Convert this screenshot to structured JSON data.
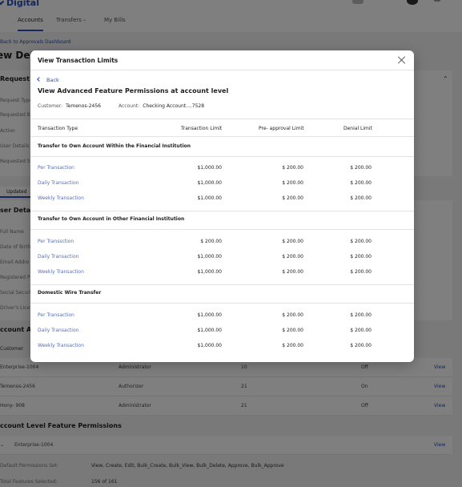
{
  "background": {
    "brand": "Digital",
    "nav": [
      "Accounts",
      "Transfers",
      "My Bills"
    ],
    "breadcrumb": "Back to Approvals Dashboard",
    "page_title": "ew Deta",
    "request_details_title": "Request De",
    "request_fields": [
      "Request Type",
      "Requested B",
      "Action",
      "User Details",
      "Requested S"
    ],
    "tab_updated": "Updated",
    "user_details_title": "ser Details",
    "user_fields": [
      "Full Name",
      "Date of Birth",
      "Email Addre",
      "Registered P",
      "Social Securi",
      "Driver's Lice"
    ],
    "account_access_title": "ccount Acc",
    "customer_header": "Customer",
    "rows": [
      {
        "name": "Enterprise-1004",
        "role": "Administrator",
        "count": "10",
        "status": "Off",
        "action": "View"
      },
      {
        "name": "Temenos-2456",
        "role": "Authorizer",
        "count": "21",
        "status": "On",
        "action": "View"
      },
      {
        "name": "Hony- 908",
        "role": "Administrator",
        "count": "21",
        "status": "Off",
        "action": "View"
      }
    ],
    "feature_perm_title": "ccount Level Feature Permissions",
    "feature_row": {
      "name": "Enterprise-1004",
      "action": "View"
    },
    "default_permissions_label": "Default Permissions Set:",
    "default_permissions_value": "View, Create, Edit, Bulk_Create, Bulk_View, Bulk_Delete, Approve, Bulk_Approve",
    "total_features_label": "Total Features Selected:",
    "total_features_value": "156 of 161"
  },
  "modal": {
    "title": "View Transaction Limits",
    "back_label": "Back",
    "subtitle": "View Advanced Feature Permissions at account level",
    "customer_label": "Customer:",
    "customer_value": "Temenos-2456",
    "account_label": "Account:",
    "account_value": "Checking Account....7528",
    "columns": [
      "Transaction Type",
      "Transaction Limit",
      "Pre- approval Limit",
      "Denial Limit"
    ],
    "groups": [
      {
        "title": "Transfer to Own Account Within the Financial Institution",
        "rows": [
          {
            "type": "Per Transaction",
            "limit": "$1,000.00",
            "pre": "$ 200.00",
            "denial": "$ 200.00"
          },
          {
            "type": "Daily Transaction",
            "limit": "$1,000.00",
            "pre": "$ 200.00",
            "denial": "$ 200.00"
          },
          {
            "type": "Weekly Transaction",
            "limit": "$1,000.00",
            "pre": "$ 200.00",
            "denial": "$ 200.00"
          }
        ]
      },
      {
        "title": "Transfer to Own Account in Other Financial Institution",
        "rows": [
          {
            "type": "Per Transsction",
            "limit": "$ 200.00",
            "pre": "$ 200.00",
            "denial": "$ 200.00"
          },
          {
            "type": "Daily Transaction",
            "limit": "$1,000.00",
            "pre": "$ 200.00",
            "denial": "$ 200.00"
          },
          {
            "type": "Weekly Transaction",
            "limit": "$1,000.00",
            "pre": "$ 200.00",
            "denial": "$ 200.00"
          }
        ]
      },
      {
        "title": "Domestic Wire Transfer",
        "rows": [
          {
            "type": "Per Transaction",
            "limit": "$1,000.00",
            "pre": "$ 200.00",
            "denial": "$ 200.00"
          },
          {
            "type": "Daily Transaction",
            "limit": "$1,000.00",
            "pre": "$ 200.00",
            "denial": "$ 200.00"
          },
          {
            "type": "Weekly Transaction",
            "limit": "$1,000.00",
            "pre": "$ 200.00",
            "denial": "$ 200.00"
          }
        ]
      }
    ]
  }
}
